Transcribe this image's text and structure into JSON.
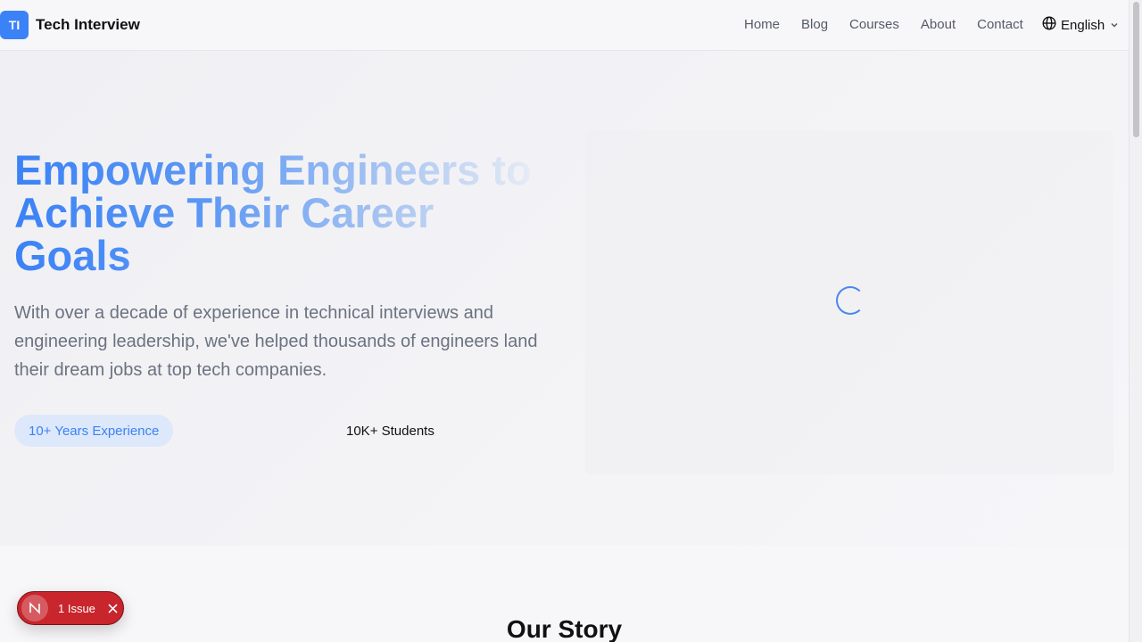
{
  "header": {
    "logo_badge": "TI",
    "logo_text": "Tech Interview",
    "nav": [
      "Home",
      "Blog",
      "Courses",
      "About",
      "Contact"
    ],
    "language": "English",
    "language_icon": "globe-icon",
    "dropdown_icon": "chevron-down-icon"
  },
  "hero": {
    "title": "Empowering Engineers to Achieve Their Career Goals",
    "subtitle": "With over a decade of experience in technical interviews and engineering leadership, we've helped thousands of engineers land their dream jobs at top tech companies.",
    "badge_experience": "10+ Years Experience",
    "badge_students": "10K+ Students",
    "loading_icon": "spinner-icon"
  },
  "story": {
    "title": "Our Story"
  },
  "dev_overlay": {
    "logo": "N",
    "issue_label": "1 Issue",
    "close_icon": "close-icon"
  },
  "colors": {
    "accent": "#3b82f6",
    "issue_red": "#c9252c",
    "muted_text": "#6b7280"
  }
}
